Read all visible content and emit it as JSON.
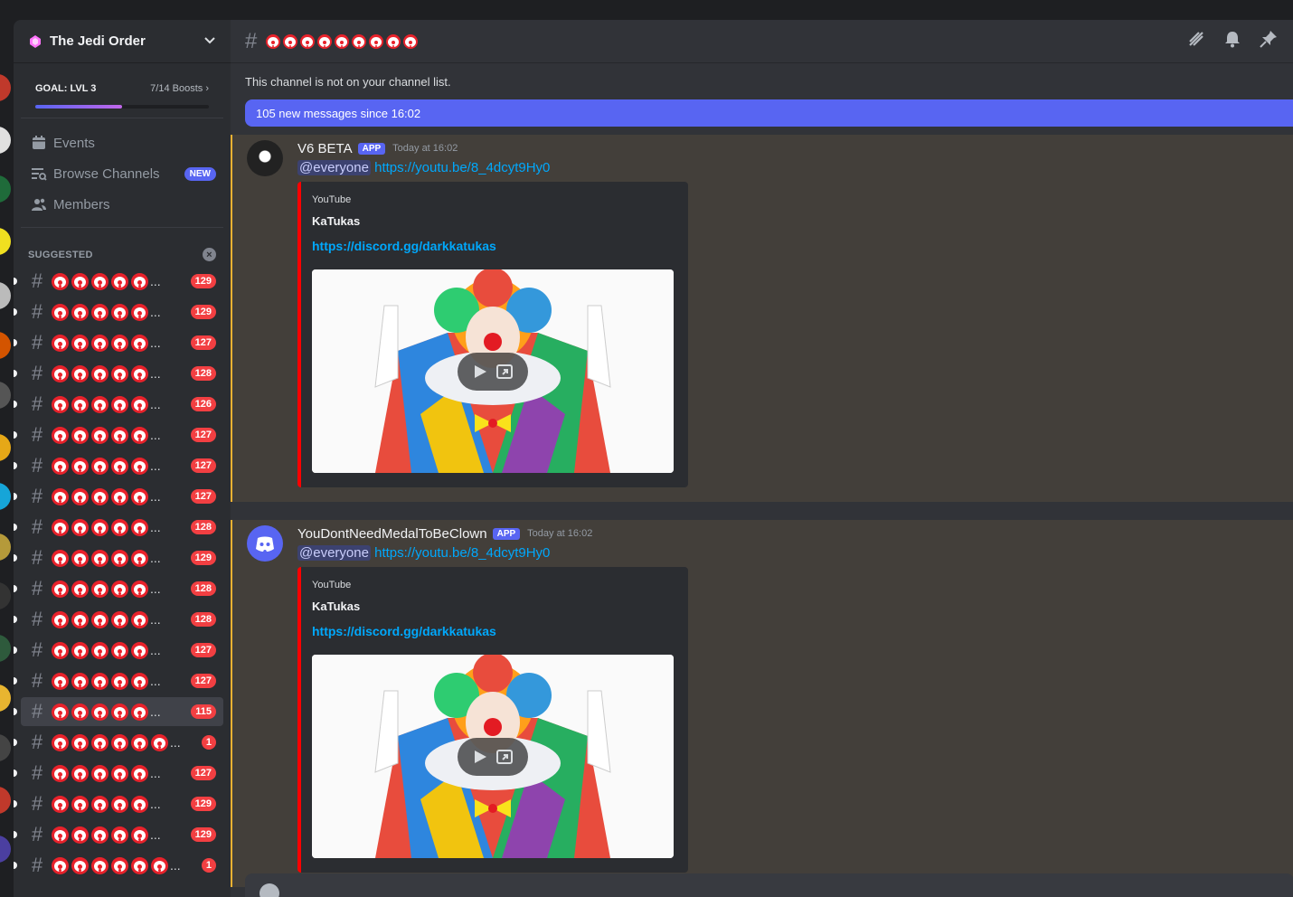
{
  "server": {
    "name": "The Jedi Order",
    "boost_goal": "GOAL: LVL 3",
    "boost_count": "7/14 Boosts",
    "boost_progress": 0.5
  },
  "nav": {
    "events": "Events",
    "browse_channels": "Browse Channels",
    "browse_badge": "NEW",
    "members": "Members"
  },
  "suggested_label": "SUGGESTED",
  "channels": [
    {
      "clowns": 5,
      "count": "129"
    },
    {
      "clowns": 5,
      "count": "129"
    },
    {
      "clowns": 5,
      "count": "127"
    },
    {
      "clowns": 5,
      "count": "128"
    },
    {
      "clowns": 5,
      "count": "126"
    },
    {
      "clowns": 5,
      "count": "127"
    },
    {
      "clowns": 5,
      "count": "127"
    },
    {
      "clowns": 5,
      "count": "127"
    },
    {
      "clowns": 5,
      "count": "128"
    },
    {
      "clowns": 5,
      "count": "129"
    },
    {
      "clowns": 5,
      "count": "128"
    },
    {
      "clowns": 5,
      "count": "128"
    },
    {
      "clowns": 5,
      "count": "127"
    },
    {
      "clowns": 5,
      "count": "127"
    },
    {
      "clowns": 5,
      "count": "115",
      "active": true
    },
    {
      "clowns": 6,
      "count": "1"
    },
    {
      "clowns": 5,
      "count": "127"
    },
    {
      "clowns": 5,
      "count": "129"
    },
    {
      "clowns": 5,
      "count": "129"
    },
    {
      "clowns": 6,
      "count": "1"
    }
  ],
  "header": {
    "clown_count": 9
  },
  "notice": "This channel is not on your channel list.",
  "new_messages_bar": "105 new messages since 16:02",
  "messages": [
    {
      "author": "V6 BETA",
      "tag": "APP",
      "time": "Today at 16:02",
      "mention": "@everyone",
      "link": "https://youtu.be/8_4dcyt9Hy0",
      "embed": {
        "provider": "YouTube",
        "title": "KaTukas",
        "description": "https://discord.gg/darkkatukas"
      }
    },
    {
      "author": "YouDontNeedMedalToBeClown",
      "tag": "APP",
      "time": "Today at 16:02",
      "mention": "@everyone",
      "link": "https://youtu.be/8_4dcyt9Hy0",
      "embed": {
        "provider": "YouTube",
        "title": "KaTukas",
        "description": "https://discord.gg/darkkatukas"
      }
    }
  ],
  "colors": {
    "accent": "#5865f2",
    "unread_badge": "#f23f42",
    "mention_highlight": "#f0b232",
    "embed_border": "#ff0000"
  }
}
